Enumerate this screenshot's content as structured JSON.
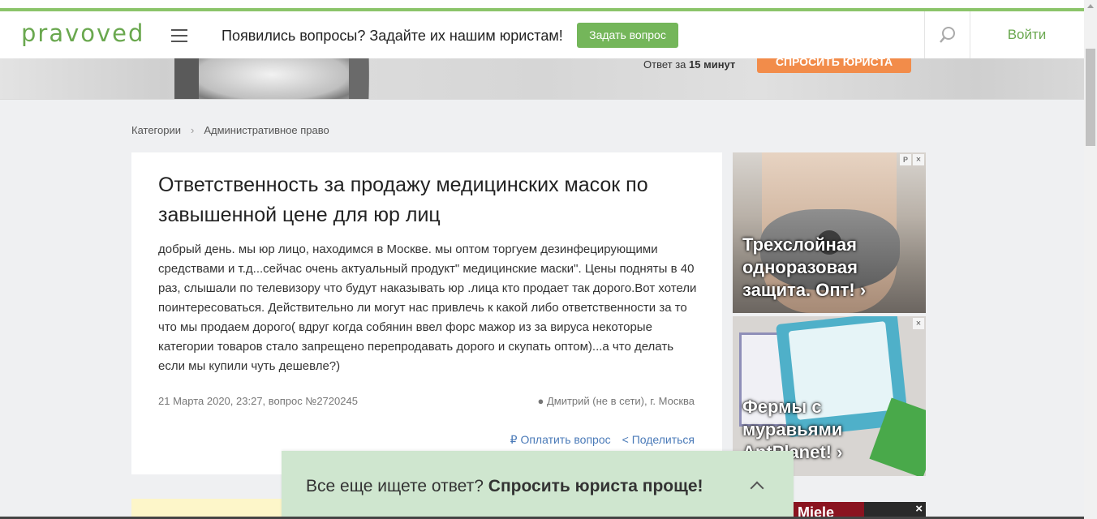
{
  "header": {
    "logo": "pravoved",
    "tagline": "Появились вопросы? Задайте их нашим юристам!",
    "ask_button": "Задать вопрос",
    "login": "Войти"
  },
  "banner": {
    "answer_prefix": "Ответ за",
    "answer_time": "15 минут",
    "button": "СПРОСИТЬ ЮРИСТА"
  },
  "breadcrumbs": {
    "items": [
      "Категории",
      "Административное право"
    ],
    "separator": "›"
  },
  "question": {
    "title": "Ответственность за продажу медицинских масок по завышенной цене для юр лиц",
    "body": "добрый день. мы юр лицо, находимся в Москве. мы оптом торгуем дезинфецирующими средствами и т.д...сейчас очень актуальный продукт\" медицинские маски\". Цены подняты в 40 раз, слышали по телевизору что будут наказывать юр .лица кто продает так дорого.Вот хотели поинтересоваться. Действительно ли могут нас привлечь к какой либо ответственности за то что мы продаем дорого( вдруг когда собянин ввел форс мажор из за вируса некоторые категории товаров стало запрещено перепродавать дорого и скупать оптом)...а что делать если мы купили чуть дешевле?)",
    "date_meta": "21 Марта 2020, 23:27, вопрос №2720245",
    "author_meta": "● Дмитрий (не в сети), г. Москва",
    "pay_action": "₽ Оплатить вопрос",
    "share_action": "< Поделиться"
  },
  "ads": {
    "ad1_text": "Трехслойная одноразовая защита. Опт! ›",
    "ad2_text": "Фермы с муравьями AntPlanet! ›",
    "ad3_brand": "Miele",
    "info_glyph": "P",
    "close_glyph": "×"
  },
  "sticky": {
    "prefix": "Все еще ищете ответ?",
    "bold": "Спросить юриста проще!"
  }
}
